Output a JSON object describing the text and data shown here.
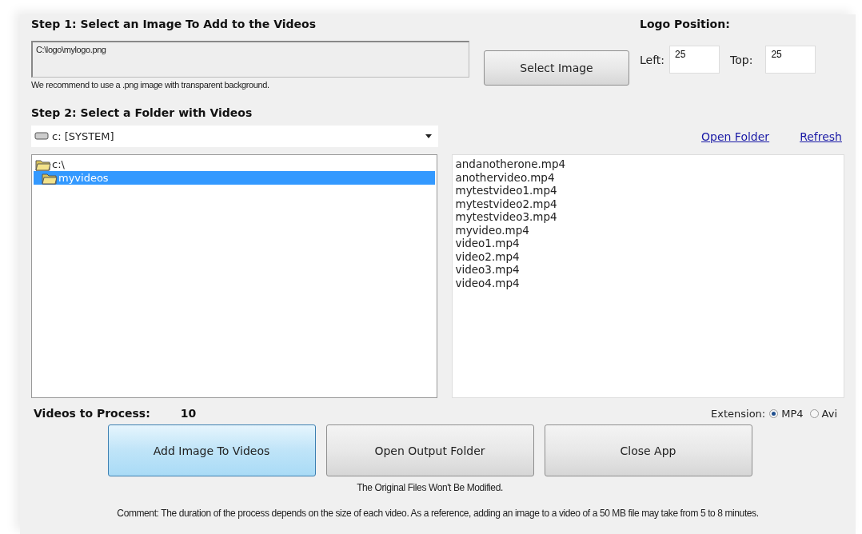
{
  "step1": {
    "title": "Step 1: Select an Image To Add to the Videos",
    "path_value": "C:\\logo\\mylogo.png",
    "hint": "We recommend to use a .png image with transparent background.",
    "button": "Select Image"
  },
  "logo_position": {
    "title": "Logo Position:",
    "left_label": "Left:",
    "left_value": "25",
    "top_label": "Top:",
    "top_value": "25"
  },
  "step2": {
    "title": "Step 2: Select a Folder with Videos",
    "drive": "c: [SYSTEM]",
    "links": [
      "Open Folder",
      "Refresh"
    ],
    "tree": [
      {
        "label": "c:\\",
        "selected": false,
        "children": [
          {
            "label": "myvideos",
            "selected": true
          }
        ]
      }
    ],
    "files": [
      "andanotherone.mp4",
      "anothervideo.mp4",
      "mytestvideo1.mp4",
      "mytestvideo2.mp4",
      "mytestvideo3.mp4",
      "myvideo.mp4",
      "video1.mp4",
      "video2.mp4",
      "video3.mp4",
      "video4.mp4"
    ]
  },
  "videos_to_process": {
    "label": "Videos to Process:",
    "count": "10"
  },
  "extension": {
    "label": "Extension:",
    "options": [
      {
        "label": "MP4",
        "selected": true
      },
      {
        "label": "Avi",
        "selected": false
      }
    ]
  },
  "buttons": [
    {
      "label": "Add Image To Videos",
      "highlighted": true
    },
    {
      "label": "Open Output Folder",
      "highlighted": false
    },
    {
      "label": "Close App",
      "highlighted": false
    }
  ],
  "note": "The Original Files Won't Be Modified.",
  "comment": "Comment: The duration of the process depends on the size of each  video. As a reference, adding an image to a video of a 50 MB file may take from 5 to 8 minutes."
}
